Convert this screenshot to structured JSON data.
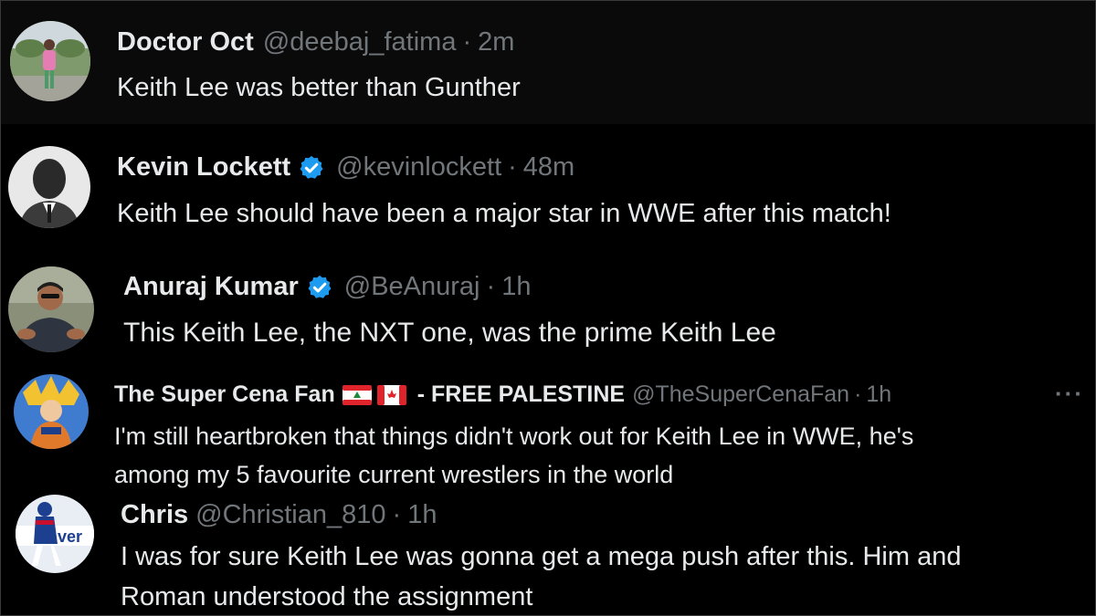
{
  "colors": {
    "background": "#000000",
    "text_primary": "#e7e9ea",
    "text_secondary": "#71767b",
    "verified_blue": "#1d9bf0"
  },
  "posts": [
    {
      "name": "Doctor Oct",
      "handle": "@deebaj_fatima",
      "separator": "·",
      "time": "2m",
      "text": "Keith Lee was better than Gunther",
      "verified": false,
      "avatar_icon": "profile-photo-avatar"
    },
    {
      "name": "Kevin Lockett",
      "handle": "@kevinlockett",
      "separator": "·",
      "time": "48m",
      "text": "Keith Lee should have been a major star in WWE after this match!",
      "verified": true,
      "avatar_icon": "profile-photo-avatar"
    },
    {
      "name": "Anuraj Kumar",
      "handle": "@BeAnuraj",
      "separator": "·",
      "time": "1h",
      "text": "This Keith Lee, the NXT one, was the prime Keith Lee",
      "verified": true,
      "avatar_icon": "profile-photo-avatar"
    },
    {
      "name_start": "The Super Cena Fan",
      "name_end": "- FREE PALESTINE",
      "flags": [
        "lebanon-flag-icon",
        "canada-flag-icon"
      ],
      "handle": "@TheSuperCenaFan",
      "separator": "·",
      "time": "1h",
      "more": "···",
      "text_line1": "I'm still heartbroken that things didn't work out for Keith Lee in WWE, he's",
      "text_line2": "among my 5 favourite current wrestlers in the world",
      "verified": false,
      "avatar_icon": "profile-photo-avatar"
    },
    {
      "name": "Chris",
      "handle": "@Christian_810",
      "separator": "·",
      "time": "1h",
      "text_line1": "I was for sure Keith Lee was gonna get a mega push after this. Him and",
      "text_line2": "Roman understood the assignment",
      "verified": false,
      "avatar_icon": "profile-photo-avatar",
      "avatar_text": "ver"
    }
  ]
}
